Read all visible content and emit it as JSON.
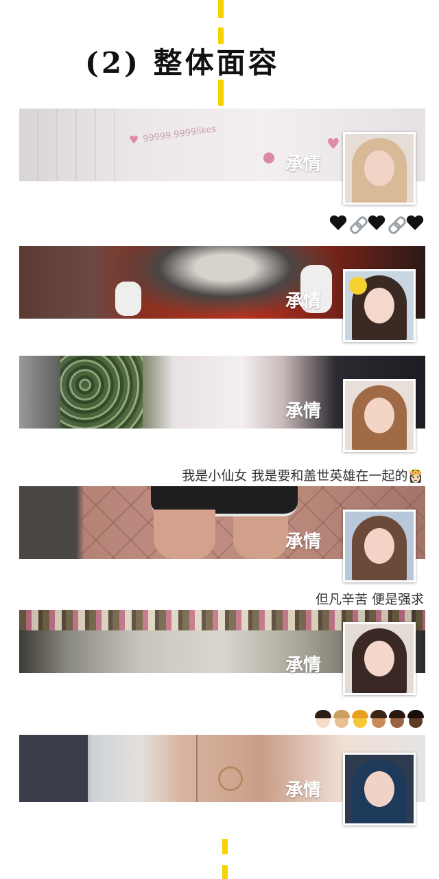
{
  "title": "(2) 整体面容",
  "colors": {
    "accent_dash": "#f7d100",
    "background": "#ffffff",
    "name_text": "#ffffff"
  },
  "profiles": [
    {
      "name": "承情",
      "cover_overlay_text": "99999.9999likes",
      "after": {
        "type": "emoji",
        "items": [
          "black-heart",
          "link",
          "black-heart",
          "link",
          "black-heart"
        ]
      }
    },
    {
      "name": "承情",
      "after": null
    },
    {
      "name": "承情",
      "after": {
        "type": "bio",
        "text": "我是小仙女 我是要和盖世英雄在一起的👸🏻"
      }
    },
    {
      "name": "承情",
      "after": {
        "type": "bio",
        "text": "但凡辛苦 便是强求"
      }
    },
    {
      "name": "承情",
      "after": {
        "type": "emoji",
        "items": [
          "princess-light",
          "princess-medium-light",
          "princess",
          "princess-medium",
          "princess-medium-dark",
          "princess-dark"
        ]
      }
    },
    {
      "name": "承情",
      "after": null
    }
  ]
}
